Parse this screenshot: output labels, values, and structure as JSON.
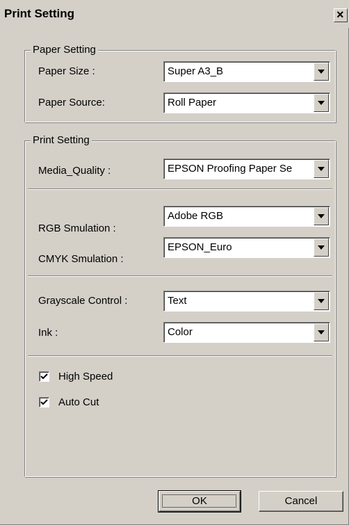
{
  "window": {
    "title": "Print Setting",
    "close_glyph": "×"
  },
  "paper_setting": {
    "legend": "Paper Setting",
    "paper_size": {
      "label": "Paper Size :",
      "value": "Super A3_B"
    },
    "paper_source": {
      "label": "Paper Source:",
      "value": "Roll Paper"
    }
  },
  "print_setting": {
    "legend": "Print Setting",
    "media_quality": {
      "label": "Media_Quality :",
      "value": "EPSON Proofing Paper Se"
    },
    "rgb_simulation": {
      "label": "RGB Smulation :",
      "value": "Adobe RGB"
    },
    "cmyk_simulation": {
      "label": "CMYK Smulation :",
      "value": "EPSON_Euro"
    },
    "grayscale_control": {
      "label": "Grayscale Control :",
      "value": "Text"
    },
    "ink": {
      "label": "Ink :",
      "value": "Color"
    },
    "high_speed": {
      "label": "High Speed",
      "checked": true
    },
    "auto_cut": {
      "label": "Auto Cut",
      "checked": true
    }
  },
  "buttons": {
    "ok": "OK",
    "cancel": "Cancel"
  },
  "icons": {
    "dropdown": "chevron-down-icon",
    "check": "checkmark-icon",
    "close": "close-icon"
  }
}
